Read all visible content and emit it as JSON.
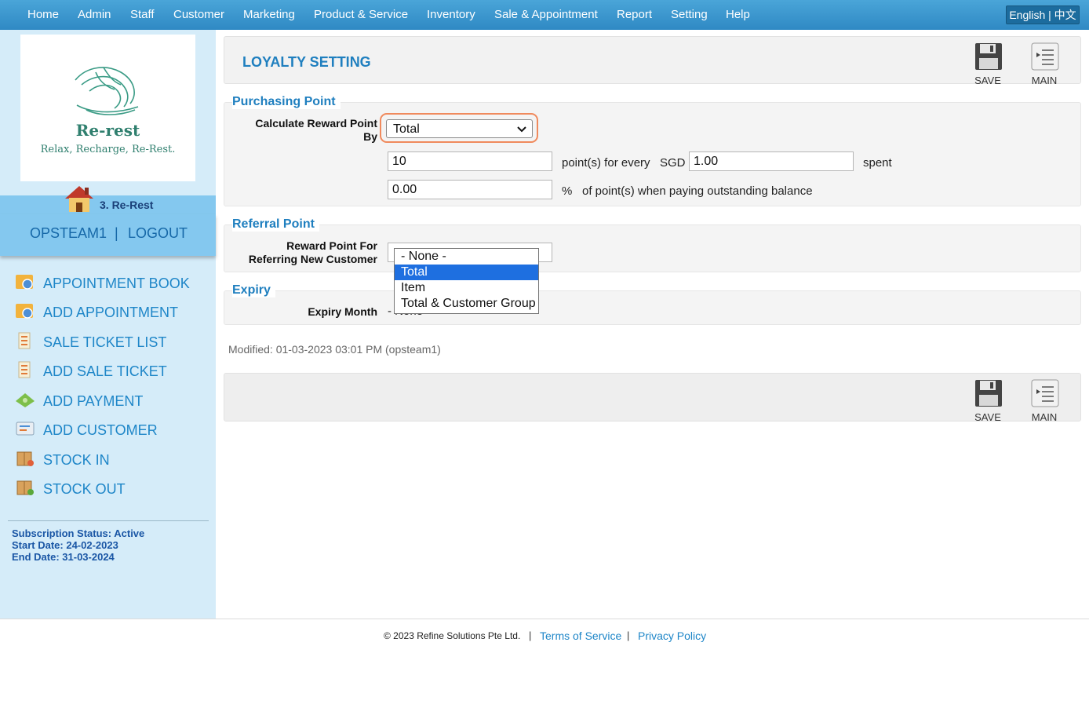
{
  "nav": {
    "items": [
      "Home",
      "Admin",
      "Staff",
      "Customer",
      "Marketing",
      "Product & Service",
      "Inventory",
      "Sale & Appointment",
      "Report",
      "Setting",
      "Help"
    ],
    "lang_en": "English",
    "lang_sep": "|",
    "lang_cn": "中文"
  },
  "sidebar": {
    "logo_title": "Re-rest",
    "logo_tagline": "Relax, Recharge, Re-Rest.",
    "branch": "3. Re-Rest",
    "username": "OPSTEAM1",
    "separator": "|",
    "logout": "LOGOUT",
    "menu": [
      {
        "label": "APPOINTMENT BOOK",
        "icon": "appointment-book-icon"
      },
      {
        "label": "ADD APPOINTMENT",
        "icon": "add-appointment-icon"
      },
      {
        "label": "SALE TICKET LIST",
        "icon": "sale-ticket-list-icon"
      },
      {
        "label": "ADD SALE TICKET",
        "icon": "add-sale-ticket-icon"
      },
      {
        "label": "ADD PAYMENT",
        "icon": "payment-icon"
      },
      {
        "label": "ADD CUSTOMER",
        "icon": "add-customer-icon"
      },
      {
        "label": "STOCK IN",
        "icon": "stock-in-icon"
      },
      {
        "label": "STOCK OUT",
        "icon": "stock-out-icon"
      }
    ],
    "subscription_status": "Subscription Status: Active",
    "start_date": "Start Date: 24-02-2023",
    "end_date": "End Date: 31-03-2024"
  },
  "page": {
    "title": "LOYALTY SETTING",
    "save_label": "SAVE",
    "main_label": "MAIN"
  },
  "purchasing": {
    "section_title": "Purchasing Point",
    "calc_label_line1": "Calculate Reward Point",
    "calc_label_line2": "By",
    "calc_selected": "Total",
    "points_value": "10",
    "points_for_every": "point(s) for every",
    "currency": "SGD",
    "amount_value": "1.00",
    "spent": "spent",
    "percent_value": "0.00",
    "percent_sign": "%",
    "outstanding_text": "of point(s) when paying outstanding balance"
  },
  "referral": {
    "section_title": "Referral Point",
    "label_line1": "Reward Point For",
    "label_line2": "Referring New Customer"
  },
  "expiry": {
    "section_title": "Expiry",
    "label": "Expiry Month",
    "value": "- None"
  },
  "dropdown": {
    "options": [
      "- None -",
      "Total",
      "Item",
      "Total & Customer Group"
    ],
    "highlighted": "Total"
  },
  "modified": "Modified: 01-03-2023 03:01 PM (opsteam1)",
  "footer": {
    "copyright": "© 2023 Refine Solutions Pte Ltd.",
    "separator": "|",
    "terms": "Terms of Service",
    "privacy": "Privacy Policy"
  },
  "colors": {
    "nav_bg": "#3a97cf",
    "sidebar_bg": "#d5ecf9",
    "accent": "#1f7fbf",
    "highlight": "#f08a5d",
    "selected_option": "#1e6fe0"
  }
}
